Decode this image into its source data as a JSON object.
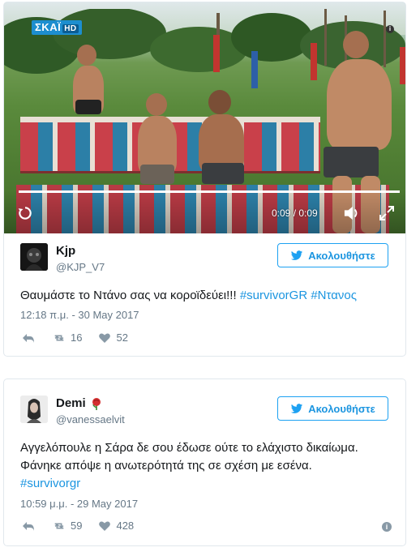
{
  "colors": {
    "link": "#1b95e0",
    "muted": "#657786",
    "border": "#e1e8ed"
  },
  "video": {
    "channel_logo": "ΣΚΑΪ",
    "channel_logo_hd": "HD",
    "info_icon": "info-icon",
    "time": "0:09 / 0:09",
    "progress_fraction": 1.0,
    "icons": [
      "replay-icon",
      "volume-icon",
      "fullscreen-icon"
    ]
  },
  "tweet1": {
    "name": "Kjp",
    "handle": "@KJP_V7",
    "follow_label": "Ακολουθήστε",
    "text_plain": "Θαυμάστε το Ντάνο σας να κοροϊδεύει!!! ",
    "hashtag1": "#survivorGR",
    "hashtag2": "#Ντανος",
    "date": "12:18 π.μ. - 30 May 2017",
    "retweets": "16",
    "likes": "52"
  },
  "tweet2": {
    "name": "Demi",
    "name_emoji": "rose-icon",
    "handle": "@vanessaelvit",
    "follow_label": "Ακολουθήστε",
    "line1": "Αγγελόπουλε η Σάρα δε σου έδωσε ούτε το ελάχιστο δικαίωμα.",
    "line2": "Φάνηκε απόψε η ανωτερότητά της σε σχέση με εσένα.",
    "hashtag": "#survivorgr",
    "date": "10:59 μ.μ. - 29 May 2017",
    "retweets": "59",
    "likes": "428"
  }
}
